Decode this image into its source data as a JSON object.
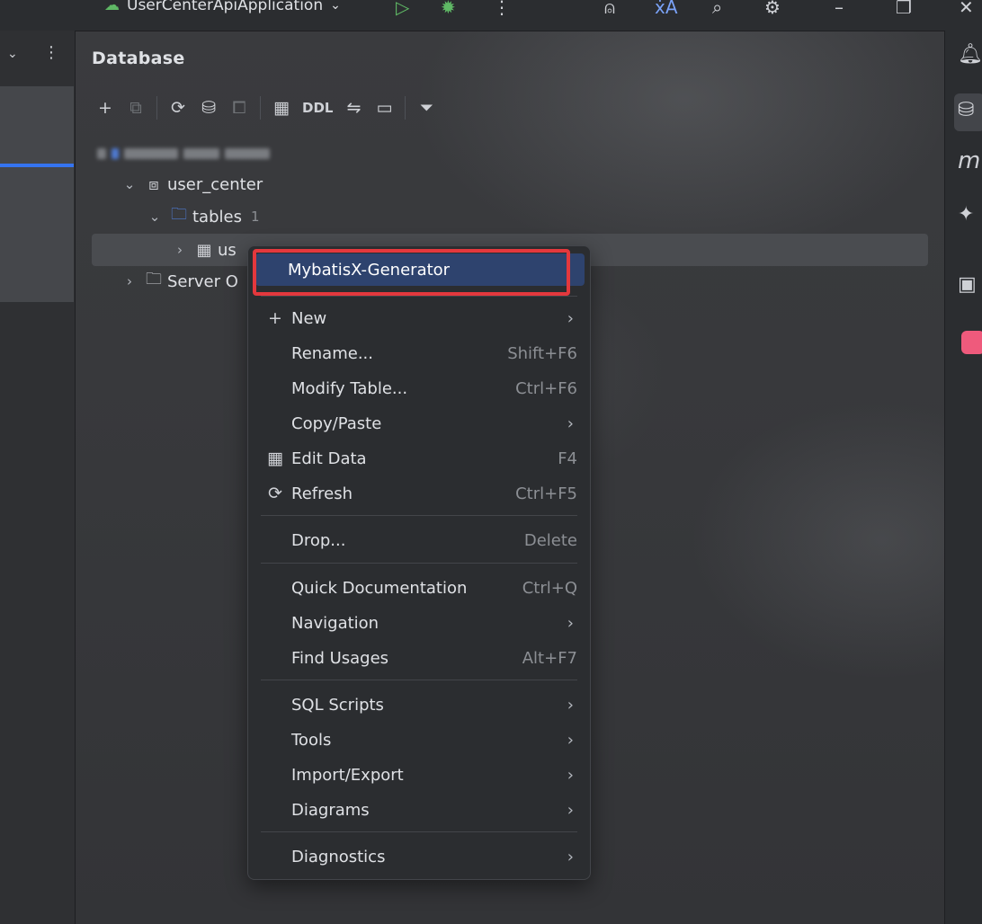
{
  "title_bar": {
    "run_config": "UserCenterApiApplication",
    "icons": [
      "run-config-icon",
      "chevron-down-icon",
      "run-icon",
      "debug-icon",
      "more-icon",
      "add-user-icon",
      "translate-icon",
      "search-icon",
      "gear-icon",
      "minimize-icon",
      "restore-icon",
      "close-icon"
    ]
  },
  "panel": {
    "title": "Database",
    "toolbar": {
      "items": [
        "add-icon",
        "duplicate-icon",
        "refresh-icon",
        "data-source-properties-icon",
        "jump-to-console-icon",
        "table-icon",
        "compare-icon",
        "console-icon",
        "filter-icon"
      ],
      "ddl_label": "DDL"
    }
  },
  "tree": {
    "schema": "user_center",
    "tables_label": "tables",
    "tables_count": "1",
    "table": "us",
    "server_objects": "Server O"
  },
  "context_menu": {
    "highlighted": "MybatisX-Generator",
    "items": [
      {
        "label": "New",
        "submenu": true
      },
      {
        "label": "Rename...",
        "shortcut": "Shift+F6"
      },
      {
        "label": "Modify Table...",
        "shortcut": "Ctrl+F6"
      },
      {
        "label": "Copy/Paste",
        "submenu": true
      },
      {
        "label": "Edit Data",
        "shortcut": "F4"
      },
      {
        "label": "Refresh",
        "shortcut": "Ctrl+F5"
      },
      {
        "label": "Drop...",
        "shortcut": "Delete"
      },
      {
        "label": "Quick Documentation",
        "shortcut": "Ctrl+Q"
      },
      {
        "label": "Navigation",
        "submenu": true
      },
      {
        "label": "Find Usages",
        "shortcut": "Alt+F7"
      },
      {
        "label": "SQL Scripts",
        "submenu": true
      },
      {
        "label": "Tools",
        "submenu": true
      },
      {
        "label": "Import/Export",
        "submenu": true
      },
      {
        "label": "Diagrams",
        "submenu": true
      },
      {
        "label": "Diagnostics",
        "submenu": true
      }
    ]
  },
  "right_strip": {
    "icons": [
      "notifications-icon",
      "database-icon",
      "mybatis-icon",
      "plugin-icon",
      "translate-panel-icon",
      "app-icon"
    ]
  },
  "colors": {
    "accent": "#3574f0",
    "highlight_bg": "#2e436e",
    "annotation_red": "#e3383d"
  }
}
